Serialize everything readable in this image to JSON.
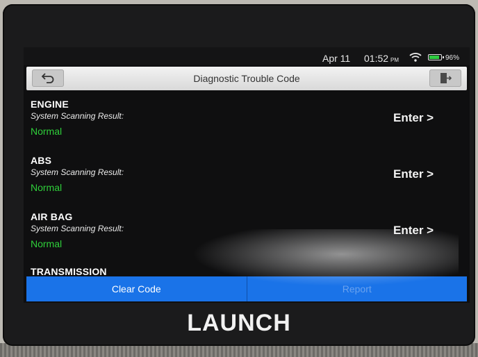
{
  "status_bar": {
    "date": "Apr 11",
    "time": "01:52",
    "ampm": "PM",
    "battery": "96%",
    "battery_level": 0.96,
    "icons": [
      "wifi-icon",
      "battery-icon"
    ]
  },
  "header": {
    "title": "Diagnostic Trouble Code",
    "back_icon": "back-arrow-icon",
    "exit_icon": "exit-door-icon"
  },
  "systems": [
    {
      "name": "ENGINE",
      "label": "System Scanning Result:",
      "status": "Normal",
      "action": "Enter >"
    },
    {
      "name": "ABS",
      "label": "System Scanning Result:",
      "status": "Normal",
      "action": "Enter >"
    },
    {
      "name": "AIR BAG",
      "label": "System Scanning Result:",
      "status": "Normal",
      "action": "Enter >"
    },
    {
      "name": "TRANSMISSION"
    }
  ],
  "bottom_bar": {
    "clear_code": "Clear Code",
    "report": "Report"
  },
  "brand": "LAUNCH",
  "colors": {
    "accent": "#1a73e8",
    "status_ok": "#2fcf3a",
    "screen_bg": "#0f0f10"
  }
}
